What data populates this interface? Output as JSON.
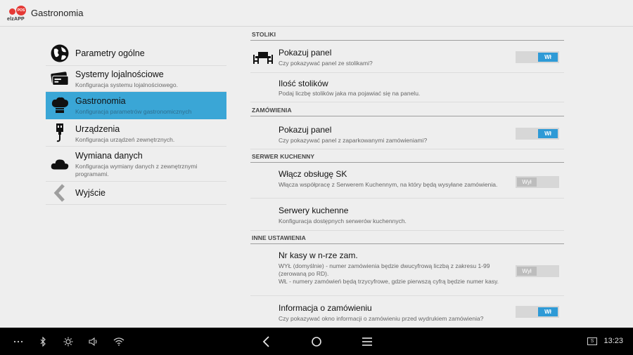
{
  "app": {
    "logo_badge": "POS",
    "logo_text": "elzAPP",
    "title": "Gastronomia"
  },
  "left_menu": [
    {
      "title": "Parametry ogólne",
      "subtitle": "",
      "icon": "globe-icon",
      "active": false
    },
    {
      "title": "Systemy lojalnościowe",
      "subtitle": "Konfiguracja systemu lojalnościowego.",
      "icon": "loyalty-card-icon",
      "active": false
    },
    {
      "title": "Gastronomia",
      "subtitle": "Konfiguracja parametrów gastronomicznych",
      "icon": "chef-hat-icon",
      "active": true
    },
    {
      "title": "Urządzenia",
      "subtitle": "Konfiguracja urządzeń zewnętrznych.",
      "icon": "usb-plug-icon",
      "active": false
    },
    {
      "title": "Wymiana danych",
      "subtitle": "Konfiguracja wymiany danych z zewnętrznymi programami.",
      "icon": "cloud-icon",
      "active": false
    },
    {
      "title": "Wyjście",
      "subtitle": "",
      "icon": "back-arrow-icon",
      "active": false
    }
  ],
  "sections": {
    "stoliki": "STOLIKI",
    "zamowienia": "ZAMÓWIENIA",
    "serwer": "SERWER KUCHENNY",
    "inne": "INNE USTAWIENIA"
  },
  "prefs": {
    "pokazuj_panel_stoliki": {
      "title": "Pokazuj panel",
      "subtitle": "Czy pokazywać panel ze stolikami?",
      "toggle": "Wł"
    },
    "ilosc_stolikow": {
      "title": "Ilość stolików",
      "subtitle": "Podaj liczbę stolików jaka ma pojawiać się na panelu."
    },
    "pokazuj_panel_zam": {
      "title": "Pokazuj panel",
      "subtitle": "Czy pokazywać panel z zaparkowanymi zamówieniami?",
      "toggle": "Wł"
    },
    "wlacz_sk": {
      "title": "Włącz obsługę SK",
      "subtitle": "Włącza współpracę z Serwerem Kuchennym, na który będą wysyłane zamówienia.",
      "toggle": "Wył"
    },
    "serwery_kuchenne": {
      "title": "Serwery kuchenne",
      "subtitle": "Konfiguracja dostępnych serwerów kuchennych."
    },
    "nr_kasy": {
      "title": "Nr kasy w n-rze zam.",
      "subtitle1": "WYŁ (domyślnie) - numer zamówienia będzie dwucyfrową liczbą z zakresu 1-99 (zerowaną po RD).",
      "subtitle2": "WŁ - numery zamówień będą trzycyfrowe, gdzie pierwszą cyfrą będzie numer kasy.",
      "toggle": "Wył"
    },
    "info_zam": {
      "title": "Informacja o zamówieniu",
      "subtitle": "Czy pokazywać okno informacji o zamówieniu przed wydrukiem zamówienia?",
      "toggle": "Wł"
    }
  },
  "navbar": {
    "time": "13:23",
    "screenshot_badge": "S"
  },
  "colors": {
    "accent": "#3aa6d6",
    "toggle_on": "#2e9ad6",
    "toggle_off": "#bdbdbd",
    "brand_red": "#e53935"
  }
}
